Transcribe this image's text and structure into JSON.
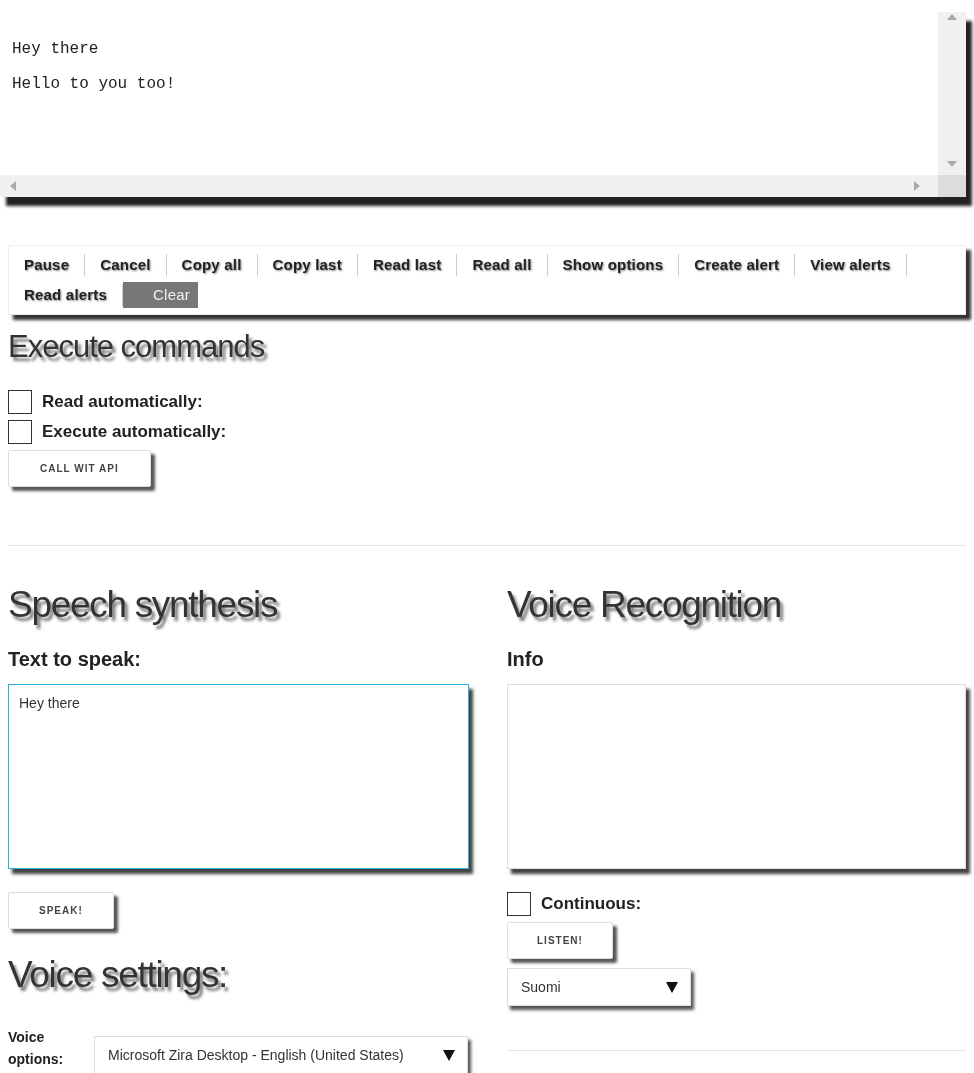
{
  "output": {
    "lines": [
      "Hey there",
      "Hello to you too!"
    ]
  },
  "toolbar": {
    "buttons": [
      "Pause",
      "Cancel",
      "Copy all",
      "Copy last",
      "Read last",
      "Read all",
      "Show options",
      "Create alert",
      "View alerts",
      "Read alerts"
    ],
    "clear": "Clear"
  },
  "execute": {
    "heading": "Execute commands",
    "options": [
      {
        "label": "Read automatically:",
        "checked": false
      },
      {
        "label": "Execute automatically:",
        "checked": false
      }
    ],
    "button": "CALL WIT API"
  },
  "synthesis": {
    "heading": "Speech synthesis",
    "label": "Text to speak:",
    "text": "Hey there",
    "focused": true,
    "button": "SPEAK!",
    "settings_heading": "Voice settings:",
    "voice_label": "Voice options:",
    "voice": "Microsoft Zira Desktop - English (United States)"
  },
  "recognition": {
    "heading": "Voice Recognition",
    "label": "Info",
    "continuous": {
      "label": "Continuous:",
      "checked": false
    },
    "button": "LISTEN!",
    "language": "Suomi"
  }
}
